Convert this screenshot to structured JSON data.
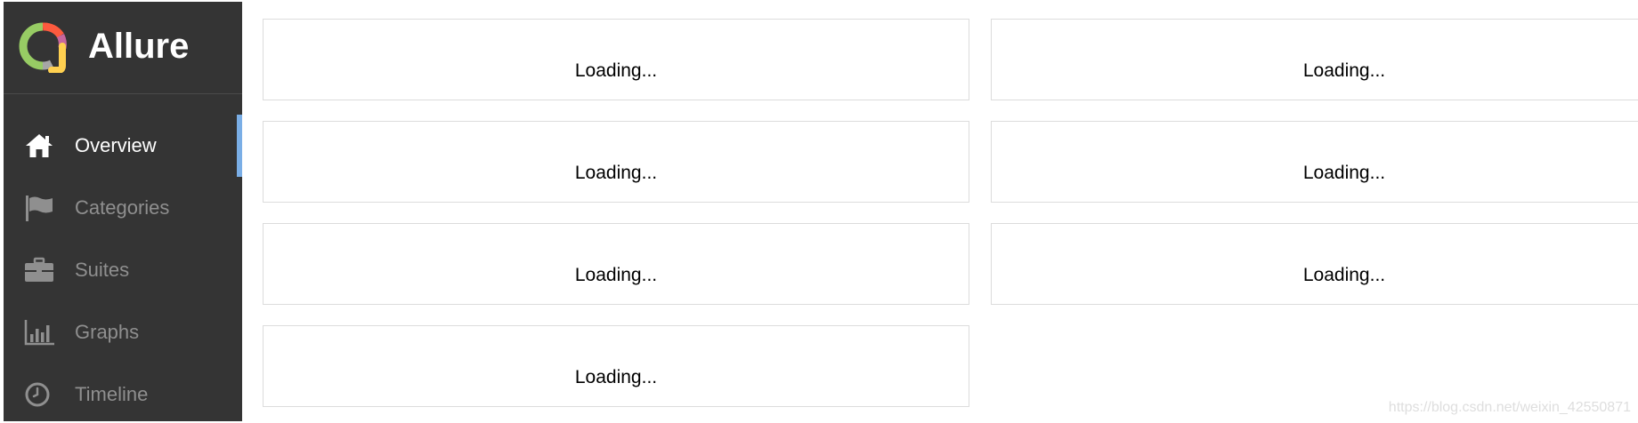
{
  "app": {
    "title": "Allure",
    "logo_colors": [
      "#97cc64",
      "#fd5a3e",
      "#ffd050",
      "#a6a6a6",
      "#c7669e"
    ]
  },
  "sidebar": {
    "background": "#343434",
    "active_color": "#7aaee6",
    "items": [
      {
        "label": "Overview",
        "icon": "home-icon",
        "active": true
      },
      {
        "label": "Categories",
        "icon": "flag-icon",
        "active": false
      },
      {
        "label": "Suites",
        "icon": "briefcase-icon",
        "active": false
      },
      {
        "label": "Graphs",
        "icon": "bar-chart-icon",
        "active": false
      },
      {
        "label": "Timeline",
        "icon": "clock-icon",
        "active": false
      }
    ]
  },
  "widgets": [
    {
      "status": "Loading..."
    },
    {
      "status": "Loading..."
    },
    {
      "status": "Loading..."
    },
    {
      "status": "Loading..."
    },
    {
      "status": "Loading..."
    },
    {
      "status": "Loading..."
    },
    {
      "status": "Loading..."
    }
  ],
  "watermark": "https://blog.csdn.net/weixin_42550871"
}
